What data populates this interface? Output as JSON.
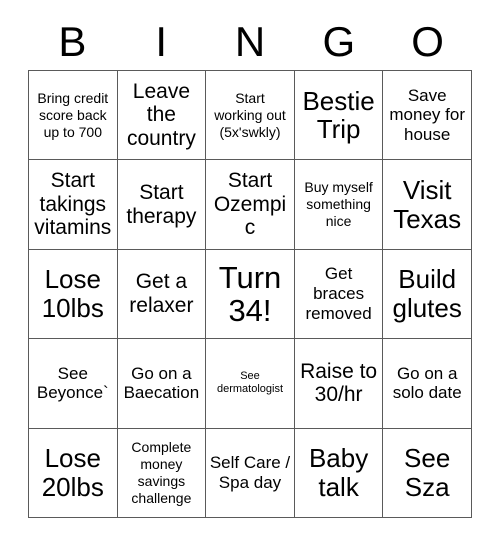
{
  "card": {
    "header_letters": [
      "B",
      "I",
      "N",
      "G",
      "O"
    ],
    "cells": [
      {
        "text": "Bring credit score back up to 700",
        "size": "sm"
      },
      {
        "text": "Leave the country",
        "size": "lg"
      },
      {
        "text": "Start working out (5x'swkly)",
        "size": "sm"
      },
      {
        "text": "Bestie Trip",
        "size": "xl"
      },
      {
        "text": "Save money for house",
        "size": "md"
      },
      {
        "text": "Start takings vitamins",
        "size": "lg"
      },
      {
        "text": "Start therapy",
        "size": "lg"
      },
      {
        "text": "Start Ozempic",
        "size": "lg"
      },
      {
        "text": "Buy myself something nice",
        "size": "sm"
      },
      {
        "text": "Visit Texas",
        "size": "xl"
      },
      {
        "text": "Lose 10lbs",
        "size": "xl"
      },
      {
        "text": "Get a relaxer",
        "size": "lg"
      },
      {
        "text": "Turn 34!",
        "size": "xxl"
      },
      {
        "text": "Get braces removed",
        "size": "md"
      },
      {
        "text": "Build glutes",
        "size": "xl"
      },
      {
        "text": "See Beyonce`",
        "size": "md"
      },
      {
        "text": "Go on a Baecation",
        "size": "md"
      },
      {
        "text": "See dermatologist",
        "size": "xs"
      },
      {
        "text": "Raise to 30/hr",
        "size": "lg"
      },
      {
        "text": "Go on a solo date",
        "size": "md"
      },
      {
        "text": "Lose 20lbs",
        "size": "xl"
      },
      {
        "text": "Complete money savings challenge",
        "size": "sm"
      },
      {
        "text": "Self Care / Spa day",
        "size": "md"
      },
      {
        "text": "Baby talk",
        "size": "xl"
      },
      {
        "text": "See Sza",
        "size": "xl"
      }
    ]
  },
  "colors": {
    "background": "#ffffff",
    "text": "#000000",
    "grid_line": "#5a5a5a"
  }
}
